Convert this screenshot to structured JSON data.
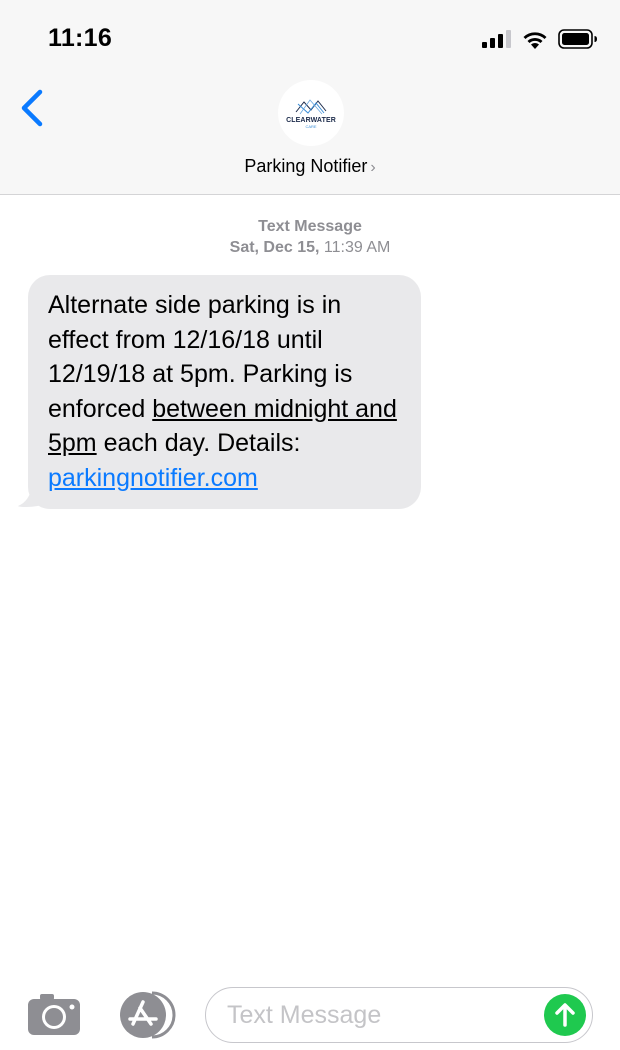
{
  "status_bar": {
    "time": "11:16"
  },
  "header": {
    "contact_name": "Parking Notifier",
    "chevron": "›",
    "avatar_label": "CLEARWATER",
    "avatar_sublabel": "CARE"
  },
  "message_meta": {
    "type_label": "Text Message",
    "date_bold": "Sat, Dec 15,",
    "time": "11:39 AM"
  },
  "message": {
    "text_part1": "Alternate side parking is in effect from 12/16/18 until 12/19/18 at 5pm. Parking is enforced ",
    "text_underlined": "between midnight and 5pm",
    "text_part2": " each day. Details: ",
    "link": "parkingnotifier.com"
  },
  "compose": {
    "placeholder": "Text Message"
  },
  "colors": {
    "accent": "#0a7aff",
    "send": "#1fc94f",
    "bubble": "#e9e9eb",
    "meta": "#8e8e93"
  },
  "icons": [
    "back-chevron-icon",
    "signal-icon",
    "wifi-icon",
    "battery-icon",
    "camera-icon",
    "app-store-icon",
    "send-arrow-icon"
  ]
}
